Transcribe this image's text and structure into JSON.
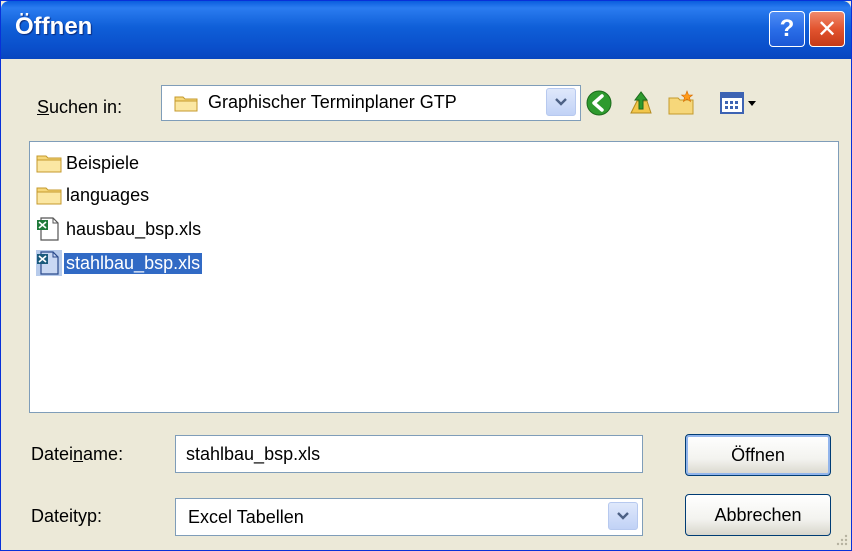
{
  "window": {
    "title": "Öffnen"
  },
  "titlebar": {
    "help_label": "?",
    "close_label": "✕"
  },
  "look_in": {
    "label_prefix": "",
    "label_accel": "S",
    "label_rest": "uchen in:",
    "value": "Graphischer Terminplaner GTP"
  },
  "toolbar": {
    "back_icon": "back-arrow-icon",
    "up_icon": "up-folder-icon",
    "new_folder_icon": "new-folder-icon",
    "view_icon": "view-menu-icon"
  },
  "files": [
    {
      "name": "Beispiele",
      "icon": "folder-icon",
      "selected": false
    },
    {
      "name": "languages",
      "icon": "folder-icon",
      "selected": false
    },
    {
      "name": "hausbau_bsp.xls",
      "icon": "excel-file-icon",
      "selected": false
    },
    {
      "name": "stahlbau_bsp.xls",
      "icon": "excel-file-icon",
      "selected": true
    }
  ],
  "filename": {
    "label_prefix": "Datei",
    "label_accel": "n",
    "label_rest": "ame:",
    "value": "stahlbau_bsp.xls"
  },
  "filetype": {
    "label": "Dateityp:",
    "value": "Excel Tabellen"
  },
  "buttons": {
    "open_label": "Öffnen",
    "cancel_label": "Abbrechen"
  },
  "colors": {
    "titlebar": "#0a4fcb",
    "selection": "#316ac5",
    "dialog_bg": "#ece9d8"
  }
}
